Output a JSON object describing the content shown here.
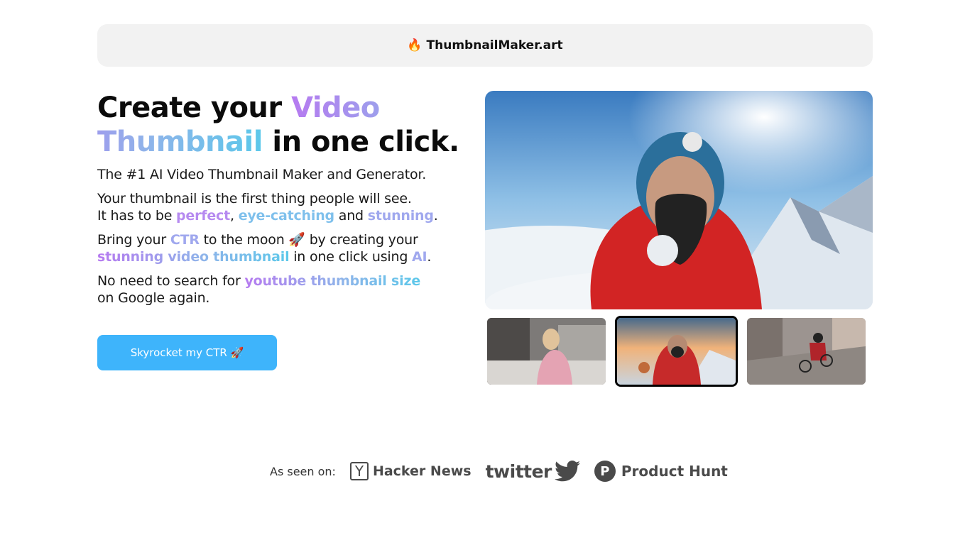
{
  "header": {
    "logo_icon": "fire-icon",
    "logo_emoji": "🔥",
    "brand": "ThumbnailMaker.art"
  },
  "hero": {
    "headline_part1": "Create your ",
    "headline_highlight": "Video Thumbnail",
    "headline_part2": " in one click.",
    "tagline": "The #1 AI Video Thumbnail Maker and Generator.",
    "p2_line1": "Your thumbnail is the first thing people will see.",
    "p2_line2_pre": "It has to be ",
    "p2_perfect": "perfect",
    "p2_comma": ", ",
    "p2_eye": "eye-catching",
    "p2_and": " and ",
    "p2_stunning": "stunning",
    "p2_end": ".",
    "p3_pre": "Bring your ",
    "p3_ctr": "CTR",
    "p3_mid": " to the moon 🚀 by creating your ",
    "p3_stunning": "stunning video thumbnail",
    "p3_mid2": " in one click using ",
    "p3_ai": "AI",
    "p3_end": ".",
    "p4_pre": "No need to search for ",
    "p4_hl": "youtube thumbnail size",
    "p4_end": " on Google again.",
    "cta_label": "Skyrocket my CTR 🚀"
  },
  "gallery": {
    "main_image": "mountaineer-selfie-with-oxygen-mask",
    "thumbnails": [
      {
        "name": "woman-drawing-at-desk",
        "selected": false
      },
      {
        "name": "mountaineer-at-summit",
        "selected": true
      },
      {
        "name": "mountain-bike-downhill-stairs",
        "selected": false
      }
    ]
  },
  "as_seen_on": {
    "label": "As seen on:",
    "hacker_news_letter": "Y",
    "hacker_news": "Hacker News",
    "twitter": "twitter",
    "product_hunt_letter": "P",
    "product_hunt": "Product Hunt"
  },
  "colors": {
    "cta": "#3eb4fb",
    "gradient_start": "#b67af0",
    "gradient_end": "#5cc8ea",
    "header_bg": "#f2f2f2"
  }
}
